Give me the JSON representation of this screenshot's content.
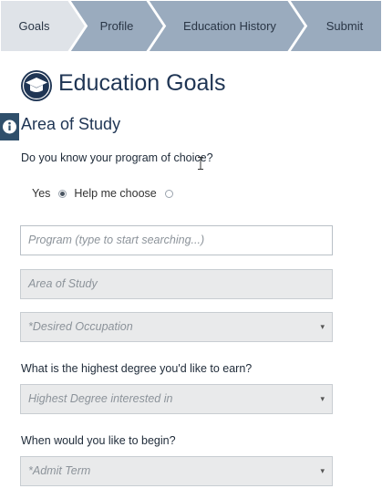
{
  "steps": [
    {
      "label": "Goals",
      "state": "active"
    },
    {
      "label": "Profile",
      "state": "inactive"
    },
    {
      "label": "Education History",
      "state": "inactive"
    },
    {
      "label": "Submit",
      "state": "inactive"
    }
  ],
  "page": {
    "title": "Education Goals",
    "title_icon": "graduation-cap-icon",
    "info_icon": "info-icon"
  },
  "section": {
    "title": "Area of Study",
    "program_question": "Do you know your program of choice?",
    "radio_options": [
      {
        "label": "Yes",
        "checked": true
      },
      {
        "label": "Help me choose",
        "checked": false
      }
    ],
    "program_placeholder": "Program (type to start searching...)",
    "area_placeholder": "Area of Study",
    "occupation_placeholder": "*Desired Occupation",
    "degree_question": "What is the highest degree you'd like to earn?",
    "degree_placeholder": "Highest Degree interested in",
    "begin_question": "When would you like to begin?",
    "term_placeholder": "*Admit Term"
  },
  "colors": {
    "step_active": "#dfe3e8",
    "step_inactive": "#9aabbe",
    "brand": "#1f3554",
    "field_disabled": "#e9eaeb"
  },
  "select_caret": "▾"
}
